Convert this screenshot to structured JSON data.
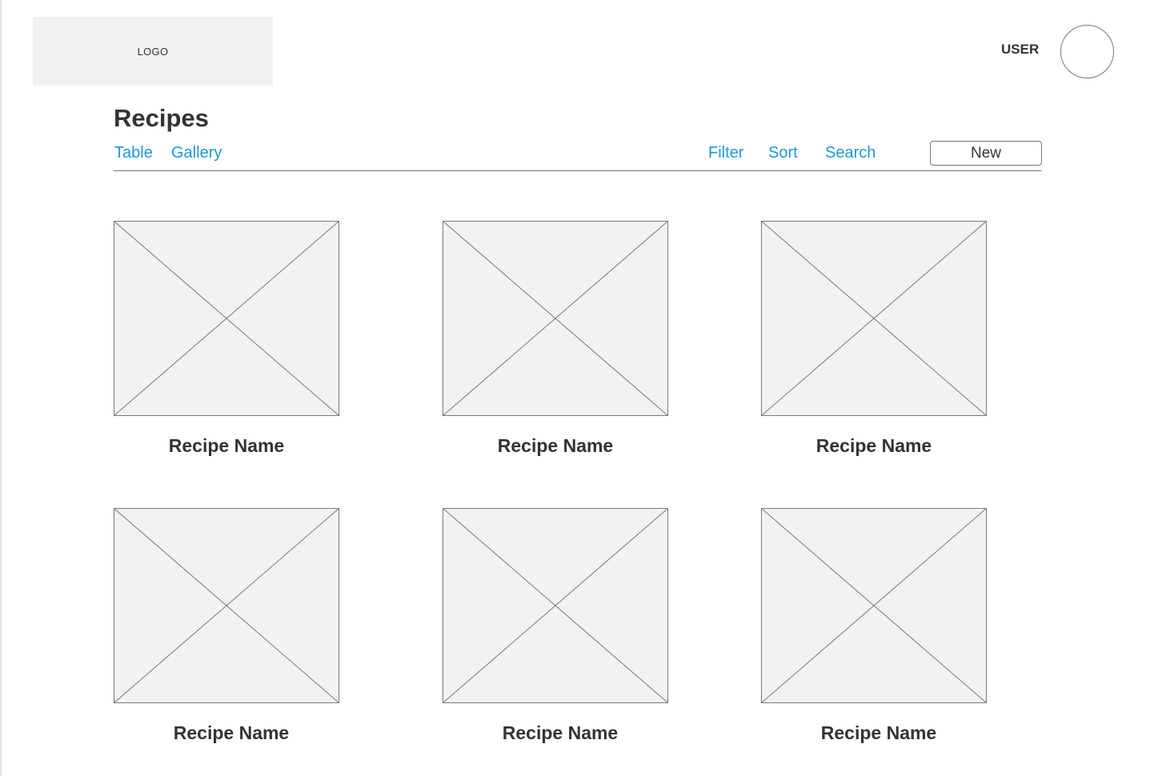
{
  "header": {
    "logo_text": "LOGO",
    "user_label": "USER"
  },
  "page": {
    "title": "Recipes"
  },
  "view_tabs": [
    "Table",
    "Gallery"
  ],
  "actions": {
    "filter": "Filter",
    "sort": "Sort",
    "search": "Search",
    "new_button": "New"
  },
  "gallery": {
    "items": [
      {
        "name": "Recipe Name",
        "image": "image-placeholder"
      },
      {
        "name": "Recipe Name",
        "image": "image-placeholder"
      },
      {
        "name": "Recipe Name",
        "image": "image-placeholder"
      },
      {
        "name": "Recipe Name",
        "image": "image-placeholder"
      },
      {
        "name": "Recipe Name",
        "image": "image-placeholder"
      },
      {
        "name": "Recipe Name",
        "image": "image-placeholder"
      }
    ]
  },
  "colors": {
    "link": "#1e98d7",
    "text": "#333333",
    "placeholder_fill": "#f2f2f2",
    "border": "#797979"
  }
}
